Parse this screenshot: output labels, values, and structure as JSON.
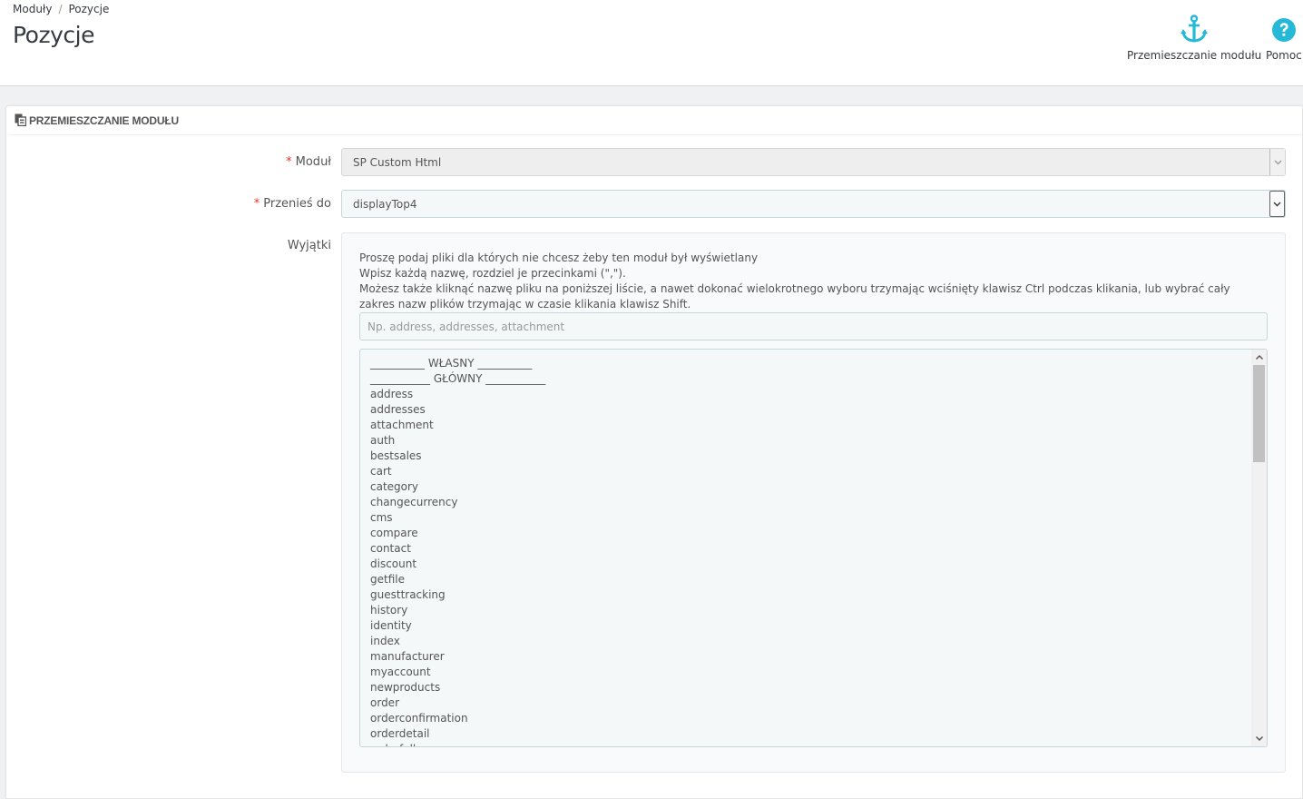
{
  "breadcrumb": {
    "parent": "Moduły",
    "separator": "/",
    "current": "Pozycje"
  },
  "page_title": "Pozycje",
  "toolbar": {
    "transplant": {
      "label": "Przemieszczanie modułu",
      "icon": "anchor-icon"
    },
    "help": {
      "label": "Pomoc",
      "icon": "question-circle-icon"
    },
    "accent": "#25b9d7"
  },
  "panel": {
    "heading": "Przemieszczanie modułu",
    "module": {
      "label": "Moduł",
      "value": "SP Custom Html"
    },
    "hook": {
      "label": "Przenieś do",
      "value": "displayTop4"
    },
    "exceptions": {
      "label": "Wyjątki",
      "help": [
        "Proszę podaj pliki dla których nie chcesz żeby ten moduł był wyświetlany",
        "Wpisz każdą nazwę, rozdziel je przecinkami (\",\").",
        "Możesz także kliknąć nazwę pliku na poniższej liście, a nawet dokonać wielokrotnego wyboru trzymając wciśnięty klawisz Ctrl podczas klikania, lub wybrać cały zakres nazw plików trzymając w czasie klikania klawisz Shift."
      ],
      "input_placeholder": "Np. address, addresses, attachment",
      "files": [
        "__________ WŁASNY __________",
        "___________ GŁÓWNY ___________",
        "address",
        "addresses",
        "attachment",
        "auth",
        "bestsales",
        "cart",
        "category",
        "changecurrency",
        "cms",
        "compare",
        "contact",
        "discount",
        "getfile",
        "guesttracking",
        "history",
        "identity",
        "index",
        "manufacturer",
        "myaccount",
        "newproducts",
        "order",
        "orderconfirmation",
        "orderdetail",
        "orderfollow"
      ]
    }
  }
}
